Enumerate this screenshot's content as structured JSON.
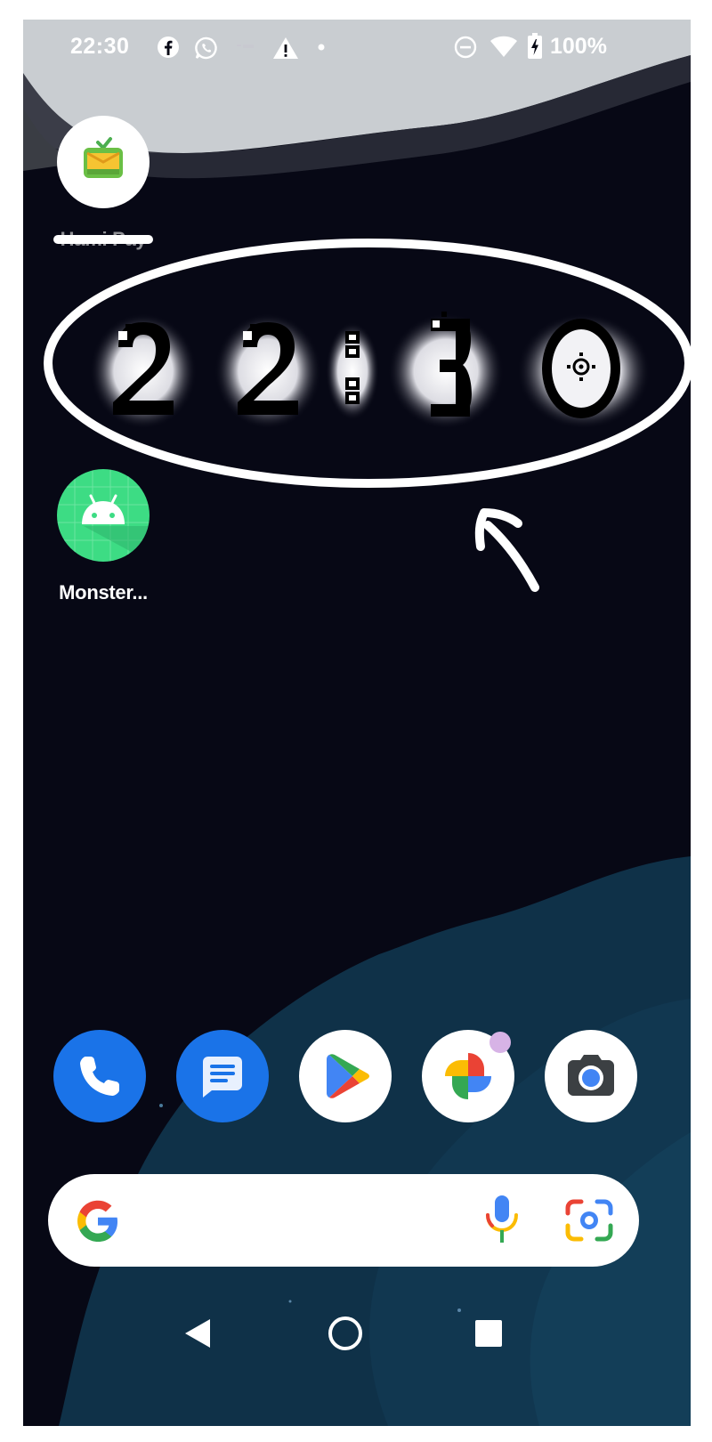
{
  "status_bar": {
    "time": "22:30",
    "notification_icons": [
      "facebook-icon",
      "whatsapp-icon",
      "small-notification-icon",
      "warning-icon",
      "more-dot-icon"
    ],
    "system_icons": [
      "do-not-disturb-icon",
      "wifi-icon",
      "battery-charging-icon"
    ],
    "battery_percent": "100%"
  },
  "home": {
    "apps": [
      {
        "label": "Hami Pay",
        "icon": "hami-pay-tv-icon",
        "label_obscured": true
      },
      {
        "label": "Monster...",
        "icon": "android-app-icon"
      }
    ],
    "clock_widget": {
      "digits": [
        "2",
        "2",
        ":",
        "3",
        "0"
      ]
    },
    "annotation": {
      "shape": "ellipse-outline",
      "pointer": "arrow"
    }
  },
  "dock": {
    "apps": [
      {
        "name": "Phone",
        "icon": "phone-icon",
        "color": "#1a73e8"
      },
      {
        "name": "Messages",
        "icon": "messages-icon",
        "color": "#1a73e8"
      },
      {
        "name": "Play Store",
        "icon": "play-store-icon",
        "color": "#ffffff"
      },
      {
        "name": "Photos",
        "icon": "photos-icon",
        "color": "#ffffff",
        "badge": true
      },
      {
        "name": "Camera",
        "icon": "camera-icon",
        "color": "#ffffff"
      }
    ]
  },
  "search_bar": {
    "logo": "google-g-icon",
    "mic": "mic-icon",
    "lens": "lens-icon"
  },
  "nav_bar": {
    "buttons": [
      "back-icon",
      "home-icon",
      "recents-icon"
    ]
  },
  "colors": {
    "background": "#070815",
    "teal_wallpaper": "#0f3148",
    "google_blue": "#4285f4",
    "google_red": "#ea4335",
    "google_yellow": "#fbbc04",
    "google_green": "#34a853"
  }
}
